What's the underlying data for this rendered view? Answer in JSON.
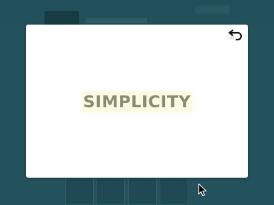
{
  "modal": {
    "word": "SIMPLICITY",
    "undo_icon": "undo-arrow-icon"
  },
  "cursor": {
    "icon": "mouse-pointer-icon"
  },
  "colors": {
    "background": "#24525c",
    "modal_bg": "#ffffff",
    "word_text": "#8a8a74",
    "word_highlight": "#fbfbe4"
  }
}
